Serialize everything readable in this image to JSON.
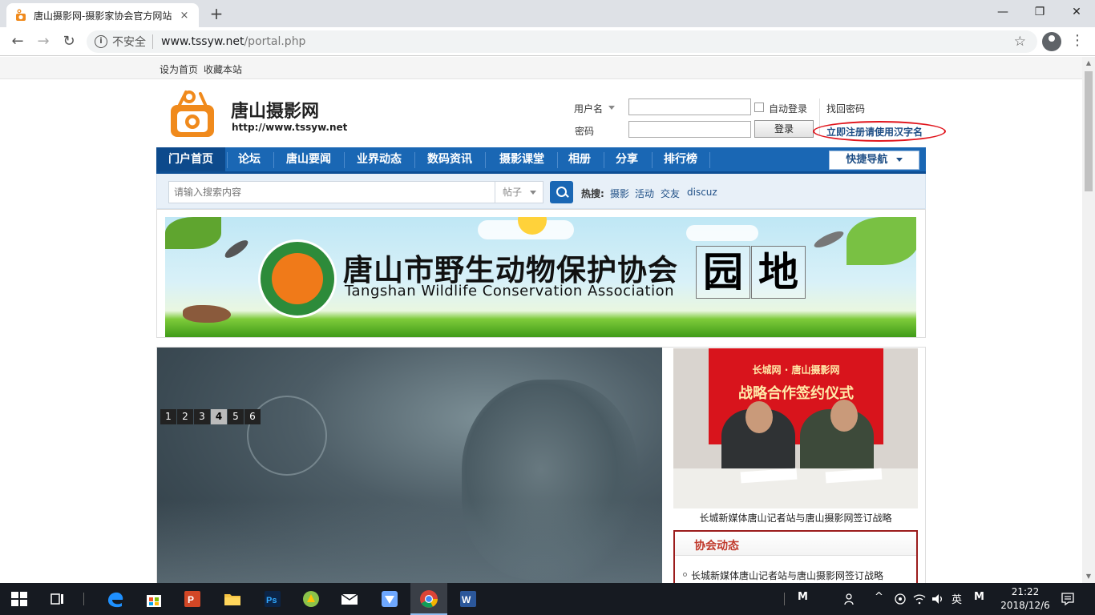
{
  "browser": {
    "tab_title": "唐山摄影网-摄影家协会官方网站",
    "tab_close": "×",
    "new_tab": "+",
    "security_label": "不安全",
    "url_host": "www.tssyw.net",
    "url_path": "/portal.php",
    "controls": {
      "minimize": "—",
      "maximize": "❐",
      "close": "✕",
      "back": "←",
      "forward": "→",
      "reload": "↻",
      "bookmark": "☆",
      "menu": "⋮"
    }
  },
  "topstrip": {
    "set_home": "设为首页",
    "bookmark_site": "收藏本站"
  },
  "header": {
    "site_name": "唐山摄影网",
    "site_url": "http://www.tssyw.net"
  },
  "login": {
    "username_label": "用户名",
    "password_label": "密码",
    "username_value": "",
    "password_value": "",
    "auto_login": "自动登录",
    "login_button": "登录",
    "find_password": "找回密码",
    "register": "立即注册请使用汉字名"
  },
  "nav": {
    "items": [
      "门户首页",
      "论坛",
      "唐山要闻",
      "业界动态",
      "数码资讯",
      "摄影课堂",
      "相册",
      "分享",
      "排行榜"
    ],
    "active_index": 0,
    "quick_nav": "快捷导航"
  },
  "search": {
    "placeholder": "请输入搜索内容",
    "type": "帖子",
    "hot_label": "热搜:",
    "hot_links": [
      "摄影",
      "活动",
      "交友",
      "discuz"
    ]
  },
  "banner": {
    "title_zh": "唐山市野生动物保护协会",
    "title_en": "Tangshan Wildlife Conservation Association",
    "suffix_chars": [
      "园",
      "地"
    ]
  },
  "slider": {
    "pages": [
      "1",
      "2",
      "3",
      "4",
      "5",
      "6"
    ],
    "current_index": 3
  },
  "feature": {
    "banner_line1": "长城网 · 唐山摄影网",
    "banner_line2": "战略合作签约仪式",
    "caption": "长城新媒体唐山记者站与唐山摄影网签订战略"
  },
  "news": {
    "heading": "协会动态",
    "items": [
      "长城新媒体唐山记者站与唐山摄影网签订战略"
    ]
  },
  "taskbar": {
    "tray_text": [
      "M",
      "英",
      "M"
    ],
    "time": "21:22",
    "date": "2018/12/6"
  },
  "colors": {
    "nav_blue": "#1a67b4",
    "register_blue": "#1f4f86",
    "annotation_red": "#e0141c",
    "news_heading": "#c0392b"
  }
}
